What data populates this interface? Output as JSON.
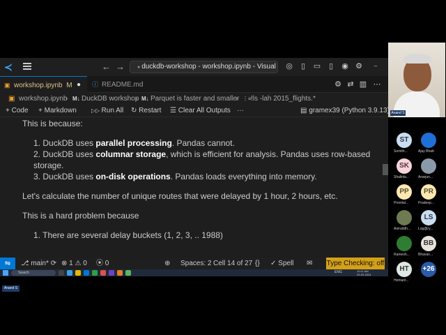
{
  "titlebar": {
    "command_center": "duckdb-workshop - workshop.ipynb - Visual Studio C"
  },
  "tabs": [
    {
      "label": "workshop.ipynb",
      "status": "M"
    },
    {
      "label": "README.md"
    }
  ],
  "breadcrumb": {
    "file": "workshop.ipynb",
    "s1": "DuckDB workshop",
    "s2": "Parquet is faster and smaller",
    "s3": "!ls -lah 2015_flights.*"
  },
  "toolbar": {
    "code": "Code",
    "markdown": "Markdown",
    "run_all": "Run All",
    "restart": "Restart",
    "clear": "Clear All Outputs",
    "more": "···",
    "kernel": "gramex39 (Python 3.9.13)"
  },
  "cell": {
    "intro": "This is because:",
    "items": [
      {
        "num": "1.",
        "pre": "DuckDB uses ",
        "bold": "parallel processing",
        "post": ". Pandas cannot."
      },
      {
        "num": "2.",
        "pre": "DuckDB uses ",
        "bold": "columnar storage",
        "post": ", which is efficient for analysis. Pandas uses row-based storage."
      },
      {
        "num": "3.",
        "pre": "DuckDB uses ",
        "bold": "on-disk operations",
        "post": ". Pandas loads everything into memory."
      }
    ],
    "para2": "Let's calculate the number of unique routes that were delayed by 1 hour, 2 hours, etc.",
    "para3": "This is a hard problem because",
    "item4": "1. There are several delay buckets (1, 2, 3, .. 1988)"
  },
  "statusbar": {
    "branch": "main*",
    "errors": "1",
    "warnings": "0",
    "ports": "0",
    "spaces": "Spaces: 2",
    "cell": "Cell 14 of 27",
    "spell": "Spell",
    "type_checking": "Type Checking: off"
  },
  "taskbar": {
    "search": "Search",
    "time": "10:11 AM",
    "date": "29-03-2024",
    "lang": "ENG"
  },
  "presenter": {
    "name": "Anand S"
  },
  "participants": [
    {
      "initials": "ST",
      "name": "Somith...",
      "bg": "#c9ddf0",
      "fg": "#334"
    },
    {
      "initials": "",
      "name": "Ajay Bhatt",
      "bg": "#1f6fd6",
      "fg": "#fff"
    },
    {
      "initials": "SK",
      "name": "Shalinla...",
      "bg": "#f6d3dd",
      "fg": "#533"
    },
    {
      "initials": "",
      "name": "Aravjun...",
      "bg": "#8a9aa8",
      "fg": "#fff"
    },
    {
      "initials": "PP",
      "name": "Premlal...",
      "bg": "#fde7b0",
      "fg": "#553"
    },
    {
      "initials": "PR",
      "name": "Pradeep...",
      "bg": "#fde7b0",
      "fg": "#553"
    },
    {
      "initials": "",
      "name": "Aniruddh...",
      "bg": "#6e7a52",
      "fg": "#fff"
    },
    {
      "initials": "LS",
      "name": "Log@ry...",
      "bg": "#c9ddf0",
      "fg": "#334"
    },
    {
      "initials": "",
      "name": "Ramesh...",
      "bg": "#2e7d32",
      "fg": "#fff"
    },
    {
      "initials": "BB",
      "name": "Bhavan...",
      "bg": "#e8e2dc",
      "fg": "#333"
    },
    {
      "initials": "HT",
      "name": "Hemant...",
      "bg": "#dde8e2",
      "fg": "#333"
    },
    {
      "initials": "+26",
      "name": "",
      "bg": "#2a5aa8",
      "fg": "#fff"
    }
  ],
  "colors": {
    "accent": "#0078d4",
    "type_checking_bg": "#d4a017",
    "editor_bg": "#1e1e1e"
  }
}
